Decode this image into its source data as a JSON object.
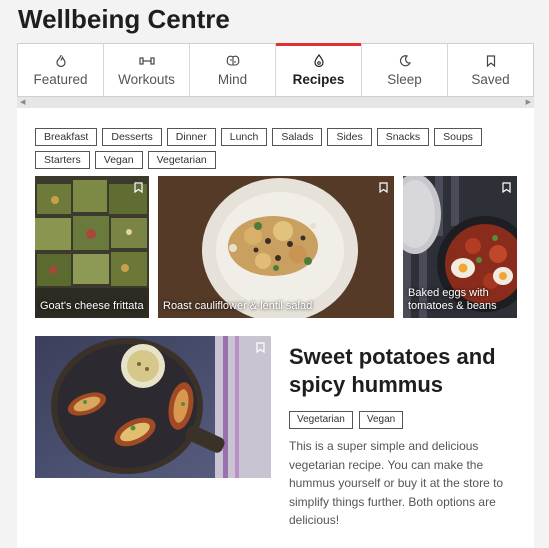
{
  "app": {
    "title": "Wellbeing Centre"
  },
  "tabs": [
    {
      "label": "Featured",
      "icon": "flame-icon"
    },
    {
      "label": "Workouts",
      "icon": "dumbbell-icon"
    },
    {
      "label": "Mind",
      "icon": "brain-icon"
    },
    {
      "label": "Recipes",
      "icon": "droplet-icon",
      "active": true
    },
    {
      "label": "Sleep",
      "icon": "moon-icon"
    },
    {
      "label": "Saved",
      "icon": "bookmark-icon"
    }
  ],
  "filters": [
    "Breakfast",
    "Desserts",
    "Dinner",
    "Lunch",
    "Salads",
    "Sides",
    "Snacks",
    "Soups",
    "Starters",
    "Vegan",
    "Vegetarian"
  ],
  "recipes": [
    {
      "caption": "Goat's cheese frittata"
    },
    {
      "caption": "Roast cauliflower & lentil salad"
    },
    {
      "caption_line1": "Baked eggs with",
      "caption_line2": "tomatoes & beans"
    }
  ],
  "featured": {
    "title": "Sweet potatoes and spicy hummus",
    "tags": [
      "Vegetarian",
      "Vegan"
    ],
    "description": "This is a super simple and delicious vegetarian recipe. You can make the hummus yourself or buy it at the store to simplify things further. Both options are delicious!"
  },
  "colors": {
    "accent": "#e03131",
    "text": "#1e1e1e"
  }
}
